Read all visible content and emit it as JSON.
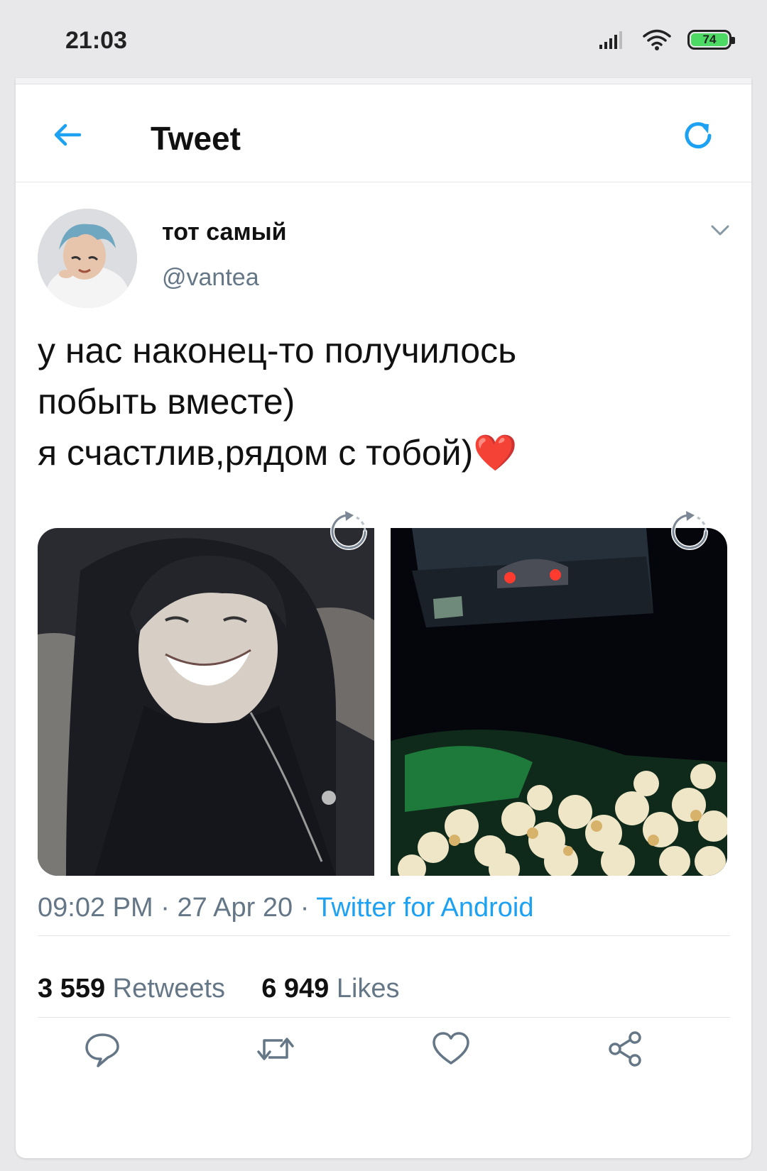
{
  "status": {
    "time": "21:03",
    "battery_level": "74",
    "battery_color": "#4cd964"
  },
  "header": {
    "title": "Tweet",
    "back_icon": "arrow-left-icon",
    "refresh_icon": "refresh-icon"
  },
  "tweet": {
    "display_name": "тот самый",
    "handle": "@vantea",
    "text_lines": [
      "у нас наконец-то получилось",
      "побыть вместе)",
      "я счастлив,рядом с тобой)❤️"
    ],
    "timestamp": "09:02 PM",
    "date": "27 Apr 20",
    "source": "Twitter for Android",
    "retweets_count": "3 559",
    "retweets_label": "Retweets",
    "likes_count": "6 949",
    "likes_label": "Likes"
  },
  "actions": [
    "reply-icon",
    "retweet-icon",
    "like-icon",
    "share-icon"
  ],
  "colors": {
    "accent": "#1da1f2",
    "secondary_text": "#657786",
    "heart": "#e0245e"
  }
}
